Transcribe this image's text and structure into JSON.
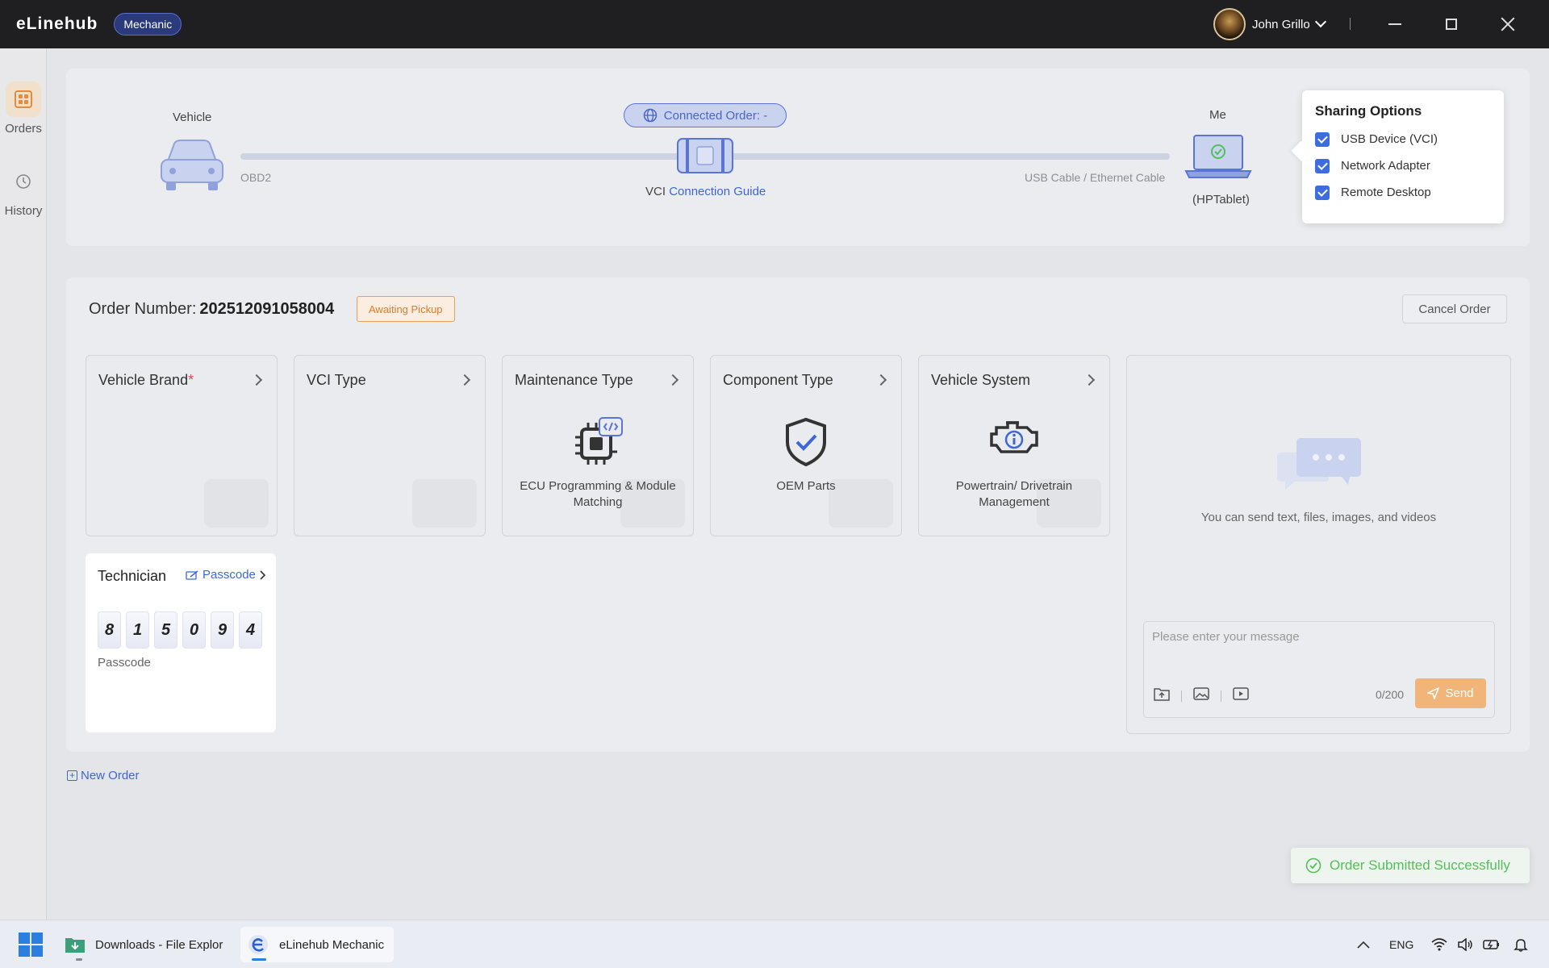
{
  "app": {
    "title": "eLinehub",
    "role_badge": "Mechanic"
  },
  "user": {
    "name": "John Grillo"
  },
  "sidebar": {
    "items": [
      {
        "label": "Orders",
        "icon": "grid-icon",
        "active": true
      },
      {
        "label": "History",
        "icon": "history-icon",
        "active": false
      }
    ]
  },
  "connection": {
    "vehicle_label": "Vehicle",
    "vehicle_port": "OBD2",
    "connected_order": "Connected Order: -",
    "vci_label": "VCI",
    "vci_guide_link": "Connection Guide",
    "cable_label": "USB Cable / Ethernet Cable",
    "me_label": "Me",
    "device_name": "(HPTablet)"
  },
  "sharing": {
    "title": "Sharing Options",
    "options": [
      {
        "label": "USB Device (VCI)",
        "checked": true
      },
      {
        "label": "Network Adapter",
        "checked": true
      },
      {
        "label": "Remote Desktop",
        "checked": true
      }
    ]
  },
  "order": {
    "number_label": "Order Number:",
    "number": "202512091058004",
    "status": "Awaiting Pickup",
    "cancel_label": "Cancel Order",
    "cards": [
      {
        "title": "Vehicle Brand",
        "required_mark": "*",
        "value": ""
      },
      {
        "title": "VCI Type",
        "value": ""
      },
      {
        "title": "Maintenance Type",
        "value": "ECU Programming & Module Matching",
        "icon": "chip-icon"
      },
      {
        "title": "Component Type",
        "value": "OEM Parts",
        "icon": "shield-check-icon"
      },
      {
        "title": "Vehicle System",
        "value": "Powertrain/ Drivetrain Management",
        "icon": "engine-icon"
      }
    ],
    "technician": {
      "title": "Technician",
      "passcode_link": "Passcode",
      "digits": [
        "8",
        "1",
        "5",
        "0",
        "9",
        "4"
      ],
      "passcode_label": "Passcode"
    },
    "chat": {
      "hint": "You can send text, files, images, and videos",
      "placeholder": "Please enter your message",
      "counter": "0/200",
      "send_label": "Send"
    }
  },
  "new_order_label": "New Order",
  "toast": {
    "message": "Order Submitted Successfully"
  },
  "taskbar": {
    "items": [
      {
        "label": "Downloads - File Explor"
      },
      {
        "label": "eLinehub Mechanic"
      }
    ],
    "tray": {
      "lang": "ENG"
    }
  },
  "colors": {
    "accent": "#3d66d6",
    "warning": "#e07b28",
    "success": "#52c05a",
    "send": "#f1b57a"
  }
}
